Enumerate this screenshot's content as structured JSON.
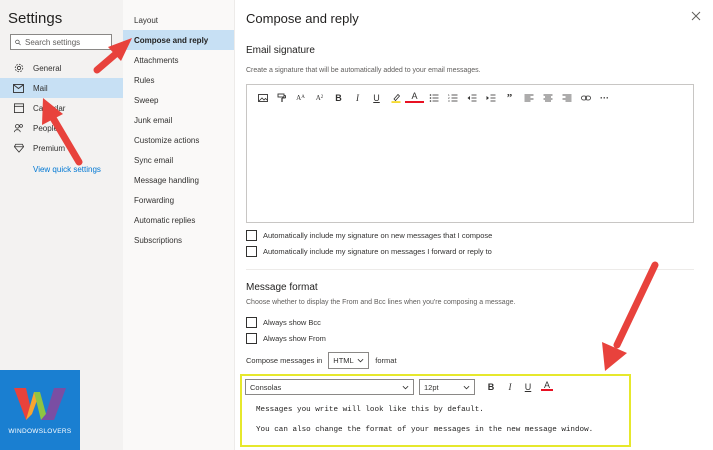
{
  "settings_title": "Settings",
  "search": {
    "placeholder": "Search settings"
  },
  "left_nav": {
    "items": [
      {
        "label": "General",
        "icon": "gear-icon"
      },
      {
        "label": "Mail",
        "icon": "mail-icon"
      },
      {
        "label": "Calendar",
        "icon": "calendar-icon"
      },
      {
        "label": "People",
        "icon": "people-icon"
      },
      {
        "label": "Premium",
        "icon": "diamond-icon"
      }
    ],
    "quick_link": "View quick settings"
  },
  "mid_nav": {
    "items": [
      "Layout",
      "Compose and reply",
      "Attachments",
      "Rules",
      "Sweep",
      "Junk email",
      "Customize actions",
      "Sync email",
      "Message handling",
      "Forwarding",
      "Automatic replies",
      "Subscriptions"
    ]
  },
  "page_title": "Compose and reply",
  "signature": {
    "title": "Email signature",
    "description": "Create a signature that will be automatically added to your email messages.",
    "check_new": "Automatically include my signature on new messages that I compose",
    "check_reply": "Automatically include my signature on messages I forward or reply to"
  },
  "toolbar": {
    "bold": "B",
    "italic": "I",
    "underline": "U",
    "font_color": "A",
    "more": "···"
  },
  "message_format": {
    "title": "Message format",
    "description": "Choose whether to display the From and Bcc lines when you're composing a message.",
    "bcc": "Always show Bcc",
    "from": "Always show From",
    "compose_prefix": "Compose messages in",
    "compose_value": "HTML",
    "compose_suffix": "format"
  },
  "preview": {
    "font": "Consolas",
    "size": "12pt",
    "bold": "B",
    "italic": "I",
    "underline": "U",
    "color": "A",
    "line1": "Messages you write will look like this by default.",
    "line2": "You can also change the format of your messages in the new message window."
  },
  "logo": {
    "text": "WINDOWSLOVERS"
  },
  "colors": {
    "accent": "#0078d4",
    "selected": "#c7e0f4",
    "highlight_box": "#e6e82c",
    "arrow": "#e8423c"
  }
}
